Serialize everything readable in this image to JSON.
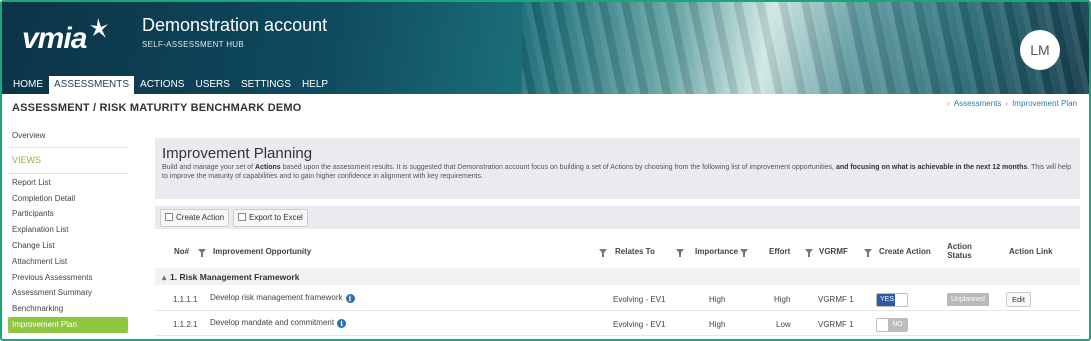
{
  "header": {
    "logo_text": "vmia",
    "title": "Demonstration account",
    "subtitle": "SELF-ASSESSMENT HUB",
    "avatar_initials": "LM"
  },
  "nav": {
    "items": [
      {
        "label": "HOME"
      },
      {
        "label": "ASSESSMENTS"
      },
      {
        "label": "ACTIONS"
      },
      {
        "label": "USERS"
      },
      {
        "label": "SETTINGS"
      },
      {
        "label": "HELP"
      }
    ],
    "active": "ASSESSMENTS"
  },
  "page": {
    "title": "ASSESSMENT / RISK MATURITY BENCHMARK DEMO",
    "breadcrumb": [
      "Assessments",
      "Improvement Plan"
    ]
  },
  "sidebar": {
    "overview": "Overview",
    "views_label": "VIEWS",
    "items": [
      {
        "label": "Report List"
      },
      {
        "label": "Completion Detail"
      },
      {
        "label": "Participants"
      },
      {
        "label": "Explanation List"
      },
      {
        "label": "Change List"
      },
      {
        "label": "Attachment List"
      },
      {
        "label": "Previous Assessments"
      },
      {
        "label": "Assessment Summary"
      },
      {
        "label": "Benchmarking"
      },
      {
        "label": "Improvement Plan"
      }
    ],
    "active": "Improvement Plan"
  },
  "main": {
    "heading": "Improvement Planning",
    "intro_pre": "Build and manage your set of ",
    "intro_bold1": "Actions",
    "intro_mid": " based upon the assessment results. It is suggested that Demonstration account focus on building a set of Actions by choosing from the following list of improvement opportunities, ",
    "intro_bold2": "and focusing on what is achievable in the next 12 months",
    "intro_post": ". This will help to improve the maturity of capabilities and to gain higher confidence in alignment with key requirements.",
    "toolbar": {
      "create_action": "Create Action",
      "export_excel": "Export to Excel"
    },
    "columns": {
      "no": "No#",
      "opportunity": "Improvement Opportunity",
      "relates_to": "Relates To",
      "importance": "Importance",
      "effort": "Effort",
      "vgrmf": "VGRMF",
      "create_action": "Create Action",
      "action_status_1": "Action",
      "action_status_2": "Status",
      "action_link": "Action Link"
    },
    "group": "1. Risk Management Framework",
    "group_toggle": "▴",
    "rows": [
      {
        "no": "1.1.1.1",
        "opportunity": "Develop risk management framework",
        "relates_to": "Evolving - EV1",
        "importance": "High",
        "effort": "High",
        "vgrmf": "VGRMF 1",
        "create_action": "YES",
        "status": "Unplanned",
        "link": "Edit"
      },
      {
        "no": "1.1.2.1",
        "opportunity": "Develop mandate and commitment",
        "relates_to": "Evolving - EV1",
        "importance": "High",
        "effort": "Low",
        "vgrmf": "VGRMF 1",
        "create_action": "NO",
        "status": "",
        "link": ""
      }
    ],
    "info_glyph": "i"
  },
  "colors": {
    "accent_green": "#8ec63f",
    "frame_green": "#1aa57a",
    "toggle_blue": "#2d5aa9",
    "link_blue": "#2a7fa8"
  }
}
